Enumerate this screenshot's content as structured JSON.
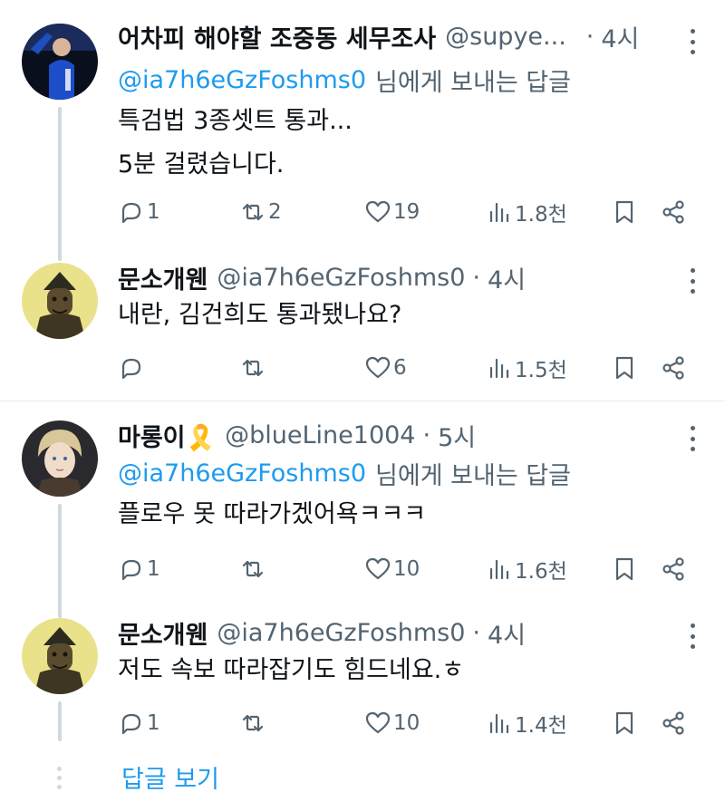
{
  "replies": [
    {
      "name": "어차피 해야할 조중동 세무조사",
      "handle": "@supye...",
      "time": "4시",
      "replying_to": "@ia7h6eGzFoshms0",
      "replying_suffix": "님에게 보내는 답글",
      "text_lines": [
        "특검법 3종셋트  통과...",
        "5분 걸렸습니다."
      ],
      "counts": {
        "reply": "1",
        "retweet": "2",
        "like": "19",
        "views": "1.8천"
      }
    },
    {
      "name": "문소개웬",
      "handle": "@ia7h6eGzFoshms0",
      "time": "4시",
      "text_lines": [
        "내란, 김건희도 통과됐나요?"
      ],
      "counts": {
        "reply": "",
        "retweet": "",
        "like": "6",
        "views": "1.5천"
      }
    },
    {
      "name": "마롱이🎗️",
      "handle": "@blueLine1004",
      "time": "5시",
      "replying_to": "@ia7h6eGzFoshms0",
      "replying_suffix": "님에게 보내는 답글",
      "text_lines": [
        "플로우 못 따라가겠어욕ㅋㅋㅋ"
      ],
      "counts": {
        "reply": "1",
        "retweet": "",
        "like": "10",
        "views": "1.6천"
      }
    },
    {
      "name": "문소개웬",
      "handle": "@ia7h6eGzFoshms0",
      "time": "4시",
      "text_lines": [
        "저도 속보 따라잡기도 힘드네요.ㅎ"
      ],
      "counts": {
        "reply": "1",
        "retweet": "",
        "like": "10",
        "views": "1.4천"
      }
    }
  ],
  "show_replies_label": "답글 보기",
  "separator_dot": "·",
  "colors": {
    "accent": "#1d9bf0",
    "muted": "#536471",
    "text": "#0f1419",
    "line": "#cfd9de"
  }
}
